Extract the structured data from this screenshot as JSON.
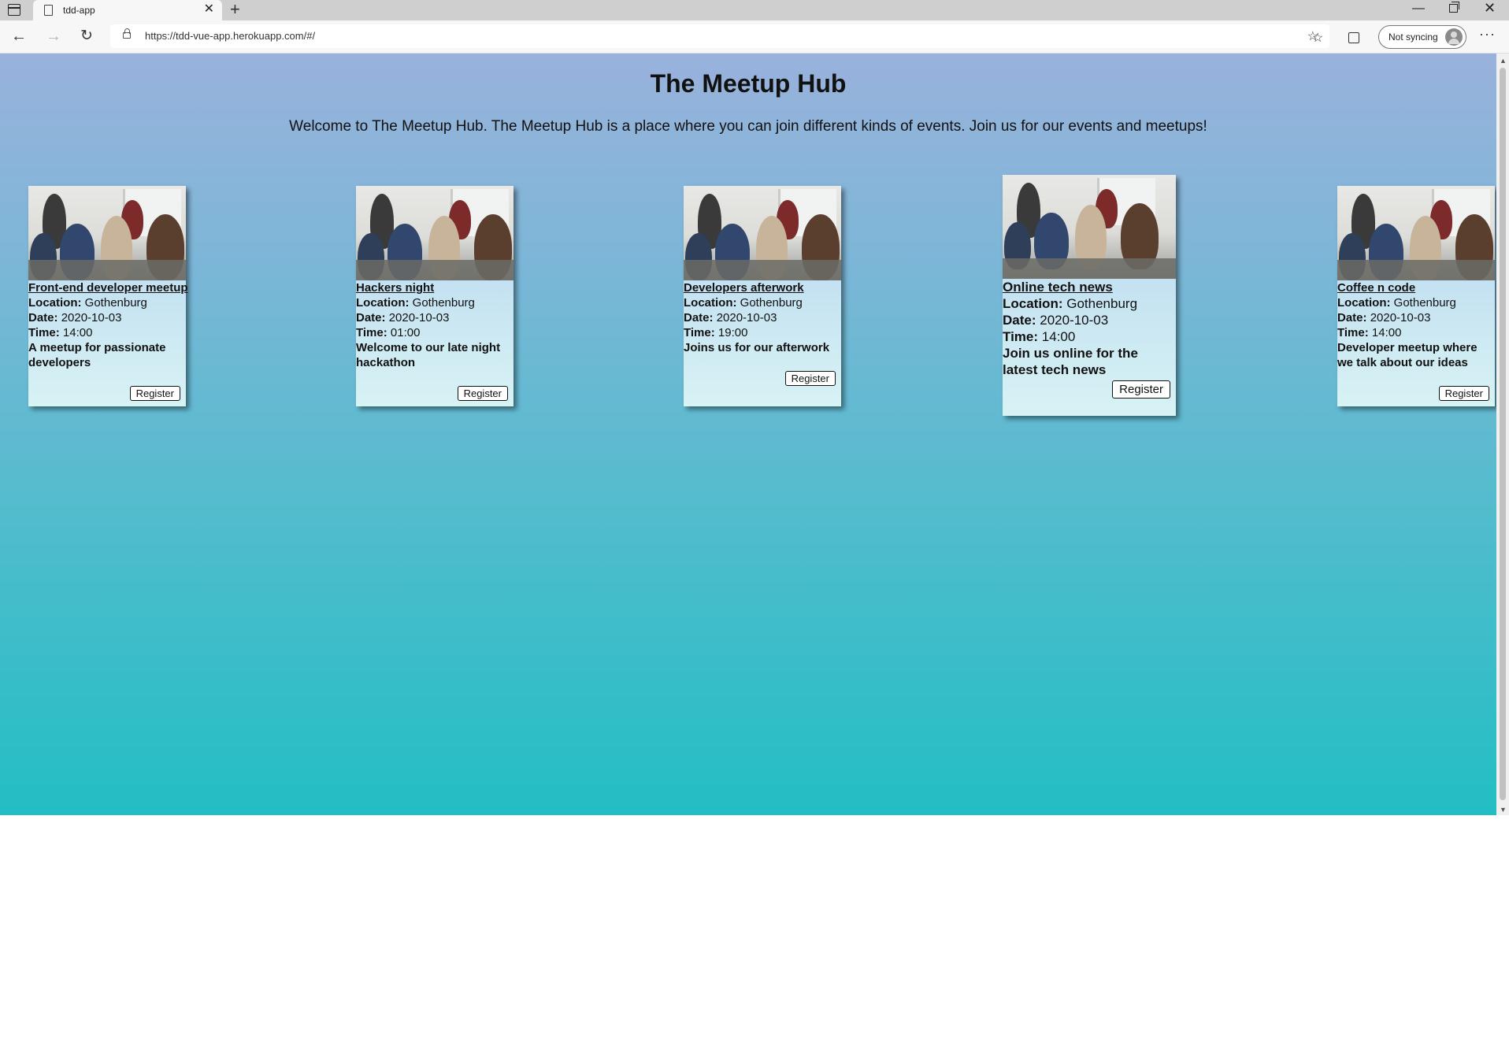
{
  "browser": {
    "tab_title": "tdd-app",
    "tab_close": "✕",
    "new_tab": "+",
    "url": "https://tdd-vue-app.herokuapp.com/#/",
    "sync_label": "Not syncing",
    "back": "←",
    "forward": "→",
    "reload": "↻",
    "fav_add": "☆",
    "favorites": "☆",
    "more": "···",
    "minimize": "—",
    "close": "✕"
  },
  "page": {
    "title": "The Meetup Hub",
    "intro": "Welcome to The Meetup Hub. The Meetup Hub is a place where you can join different kinds of events. Join us for our events and meetups!"
  },
  "labels": {
    "location": "Location:",
    "date": "Date:",
    "time": "Time:",
    "register": "Register"
  },
  "meetups": [
    {
      "title": "Front-end developer meetup",
      "location": "Gothenburg",
      "date": "2020-10-03",
      "time": "14:00",
      "description": "A meetup for passionate developers"
    },
    {
      "title": "Hackers night",
      "location": "Gothenburg",
      "date": "2020-10-03",
      "time": "01:00",
      "description": "Welcome to our late night hackathon"
    },
    {
      "title": "Developers afterwork",
      "location": "Gothenburg",
      "date": "2020-10-03",
      "time": "19:00",
      "description": "Joins us for our afterwork"
    },
    {
      "title": "Online tech news",
      "location": "Gothenburg",
      "date": "2020-10-03",
      "time": "14:00",
      "description": "Join us online for the latest tech news"
    },
    {
      "title": "Coffee n code",
      "location": "Gothenburg",
      "date": "2020-10-03",
      "time": "14:00",
      "description": "Developer meetup where we talk about our ideas"
    }
  ]
}
